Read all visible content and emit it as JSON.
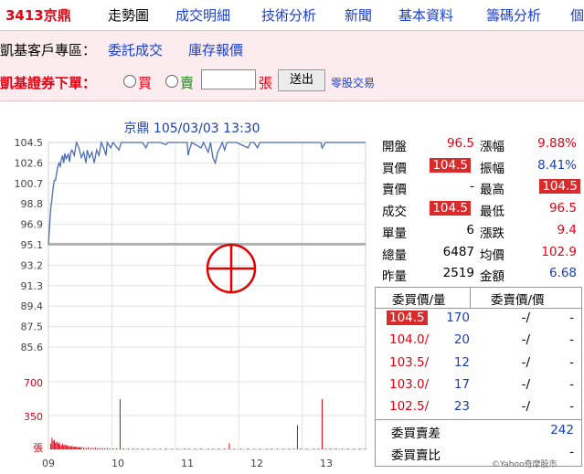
{
  "nav": {
    "stock": "3413京鼎",
    "items": [
      "走勢圖",
      "成交明細",
      "技術分析",
      "新聞",
      "基本資料",
      "籌碼分析",
      "個"
    ]
  },
  "broker": {
    "zone_label": "凱基客戶專區：",
    "link1": "委託成交",
    "link2": "庫存報價",
    "order_label": "凱基證券下單：",
    "buy_label": "買",
    "sell_label": "賣",
    "unit_label": "張",
    "submit_label": "送出",
    "odd_lot_link": "零股交易",
    "quantity_value": ""
  },
  "chart_data": {
    "type": "line",
    "title": "京鼎 105/03/03 13:30",
    "y_ticks": [
      "104.5",
      "102.6",
      "100.7",
      "98.8",
      "96.9",
      "95.1",
      "93.2",
      "91.3",
      "89.4",
      "87.5",
      "85.6"
    ],
    "ylim": [
      85.6,
      104.5
    ],
    "ref_price": 95.1,
    "x_ticks": [
      "09",
      "10",
      "11",
      "12",
      "13"
    ],
    "volume_ticks": [
      "700",
      "350",
      "張"
    ],
    "volume_max": 700,
    "price_series": [
      [
        0,
        95.1
      ],
      [
        1,
        96.9
      ],
      [
        2,
        98.5
      ],
      [
        3,
        99.3
      ],
      [
        4,
        100.3
      ],
      [
        5,
        101.0
      ],
      [
        6,
        101.0
      ],
      [
        7,
        101.7
      ],
      [
        8,
        102.3
      ],
      [
        9,
        102.6
      ],
      [
        10,
        102.3
      ],
      [
        11,
        102.9
      ],
      [
        12,
        103.3
      ],
      [
        13,
        102.6
      ],
      [
        14,
        103.5
      ],
      [
        15,
        103.0
      ],
      [
        17,
        103.4
      ],
      [
        18,
        102.7
      ],
      [
        19,
        103.6
      ],
      [
        20,
        103.8
      ],
      [
        22,
        103.3
      ],
      [
        23,
        104.0
      ],
      [
        24,
        104.5
      ],
      [
        26,
        104.0
      ],
      [
        28,
        103.1
      ],
      [
        30,
        103.6
      ],
      [
        32,
        102.6
      ],
      [
        33,
        103.8
      ],
      [
        35,
        103.1
      ],
      [
        37,
        103.6
      ],
      [
        39,
        102.6
      ],
      [
        41,
        103.8
      ],
      [
        43,
        103.3
      ],
      [
        45,
        104.5
      ],
      [
        47,
        104.0
      ],
      [
        49,
        103.3
      ],
      [
        50,
        104.5
      ],
      [
        53,
        104.0
      ],
      [
        55,
        104.5
      ],
      [
        60,
        103.8
      ],
      [
        62,
        104.5
      ],
      [
        70,
        104.5
      ],
      [
        80,
        104.5
      ],
      [
        83,
        104.0
      ],
      [
        85,
        104.5
      ],
      [
        95,
        104.5
      ],
      [
        100,
        104.3
      ],
      [
        102,
        104.5
      ],
      [
        118,
        104.5
      ],
      [
        119,
        103.3
      ],
      [
        120,
        103.8
      ],
      [
        122,
        104.5
      ],
      [
        130,
        104.0
      ],
      [
        132,
        104.5
      ],
      [
        136,
        103.6
      ],
      [
        138,
        104.5
      ],
      [
        140,
        103.1
      ],
      [
        142,
        102.6
      ],
      [
        144,
        103.6
      ],
      [
        146,
        104.0
      ],
      [
        148,
        104.5
      ],
      [
        150,
        103.8
      ],
      [
        152,
        104.5
      ],
      [
        160,
        104.5
      ],
      [
        170,
        104.0
      ],
      [
        172,
        104.5
      ],
      [
        175,
        104.5
      ],
      [
        178,
        104.0
      ],
      [
        180,
        104.5
      ],
      [
        232,
        104.5
      ],
      [
        233,
        104.0
      ],
      [
        236,
        104.5
      ],
      [
        270,
        104.5
      ]
    ],
    "volume_series": [
      [
        2,
        60
      ],
      [
        3,
        120
      ],
      [
        4,
        90
      ],
      [
        5,
        100
      ],
      [
        6,
        70
      ],
      [
        7,
        80
      ],
      [
        8,
        60
      ],
      [
        9,
        70
      ],
      [
        10,
        50
      ],
      [
        11,
        40
      ],
      [
        12,
        60
      ],
      [
        13,
        40
      ],
      [
        14,
        50
      ],
      [
        15,
        45
      ],
      [
        16,
        35
      ],
      [
        17,
        40
      ],
      [
        18,
        30
      ],
      [
        19,
        30
      ],
      [
        20,
        35
      ],
      [
        21,
        25
      ],
      [
        22,
        30
      ],
      [
        23,
        25
      ],
      [
        24,
        30
      ],
      [
        25,
        20
      ],
      [
        26,
        25
      ],
      [
        27,
        20
      ],
      [
        28,
        25
      ],
      [
        30,
        20
      ],
      [
        32,
        15
      ],
      [
        34,
        20
      ],
      [
        36,
        15
      ],
      [
        38,
        15
      ],
      [
        40,
        20
      ],
      [
        42,
        15
      ],
      [
        44,
        10
      ],
      [
        46,
        15
      ],
      [
        48,
        10
      ],
      [
        50,
        15
      ],
      [
        52,
        10
      ],
      [
        55,
        10
      ],
      [
        58,
        10
      ],
      [
        61,
        520
      ],
      [
        64,
        10
      ],
      [
        68,
        10
      ],
      [
        72,
        10
      ],
      [
        76,
        8
      ],
      [
        80,
        8
      ],
      [
        85,
        10
      ],
      [
        90,
        8
      ],
      [
        95,
        8
      ],
      [
        100,
        10
      ],
      [
        105,
        8
      ],
      [
        110,
        8
      ],
      [
        116,
        10
      ],
      [
        120,
        8
      ],
      [
        125,
        8
      ],
      [
        130,
        10
      ],
      [
        136,
        8
      ],
      [
        140,
        8
      ],
      [
        145,
        10
      ],
      [
        150,
        8
      ],
      [
        154,
        60
      ],
      [
        158,
        8
      ],
      [
        164,
        8
      ],
      [
        170,
        10
      ],
      [
        175,
        8
      ],
      [
        180,
        8
      ],
      [
        186,
        8
      ],
      [
        190,
        10
      ],
      [
        195,
        8
      ],
      [
        200,
        8
      ],
      [
        205,
        8
      ],
      [
        209,
        8
      ],
      [
        212,
        250
      ],
      [
        215,
        8
      ],
      [
        220,
        8
      ],
      [
        226,
        8
      ],
      [
        230,
        8
      ],
      [
        233,
        520
      ],
      [
        236,
        8
      ],
      [
        240,
        10
      ],
      [
        245,
        8
      ],
      [
        250,
        8
      ],
      [
        255,
        10
      ],
      [
        260,
        8
      ],
      [
        265,
        10
      ],
      [
        270,
        8
      ]
    ]
  },
  "quotes": {
    "left": [
      {
        "label": "開盤",
        "value": "96.5",
        "style": "red"
      },
      {
        "label": "買價",
        "value": "104.5",
        "style": "box"
      },
      {
        "label": "賣價",
        "value": "-",
        "style": "black"
      },
      {
        "label": "成交",
        "value": "104.5",
        "style": "box"
      },
      {
        "label": "單量",
        "value": "6",
        "style": "black"
      },
      {
        "label": "總量",
        "value": "6487",
        "style": "black"
      },
      {
        "label": "昨量",
        "value": "2519",
        "style": "black"
      }
    ],
    "right": [
      {
        "label": "漲幅",
        "value": "9.88%",
        "style": "red"
      },
      {
        "label": "振幅",
        "value": "8.41%",
        "style": "blue"
      },
      {
        "label": "最高",
        "value": "104.5",
        "style": "box"
      },
      {
        "label": "最低",
        "value": "96.5",
        "style": "red"
      },
      {
        "label": "漲跌",
        "value": "9.4",
        "style": "red"
      },
      {
        "label": "均價",
        "value": "102.9",
        "style": "red"
      },
      {
        "label": "金額",
        "value": "6.68",
        "style": "blue"
      }
    ]
  },
  "orderbook": {
    "buy_header": "委買價/量",
    "sell_header": "委賣價/價",
    "rows": [
      {
        "bid": "104.5",
        "bid_vol": "170",
        "ask": "-/",
        "ask_vol": "-",
        "hl": true
      },
      {
        "bid": "104.0/",
        "bid_vol": "20",
        "ask": "-/",
        "ask_vol": "-",
        "hl": false
      },
      {
        "bid": "103.5/",
        "bid_vol": "12",
        "ask": "-/",
        "ask_vol": "-",
        "hl": false
      },
      {
        "bid": "103.0/",
        "bid_vol": "17",
        "ask": "-/",
        "ask_vol": "-",
        "hl": false
      },
      {
        "bid": "102.5/",
        "bid_vol": "23",
        "ask": "-/",
        "ask_vol": "-",
        "hl": false
      }
    ],
    "diff_label": "委買賣差",
    "diff_value": "242",
    "ratio_label": "委買賣比",
    "ratio_value": "-"
  },
  "footer": {
    "credit": "©Yahoo奇摩股市"
  },
  "colors": {
    "red": "#e60012",
    "blue": "#1a3fb5",
    "link": "#1a3fd0",
    "line": "#4a6db5",
    "box": "#d92b2b"
  }
}
